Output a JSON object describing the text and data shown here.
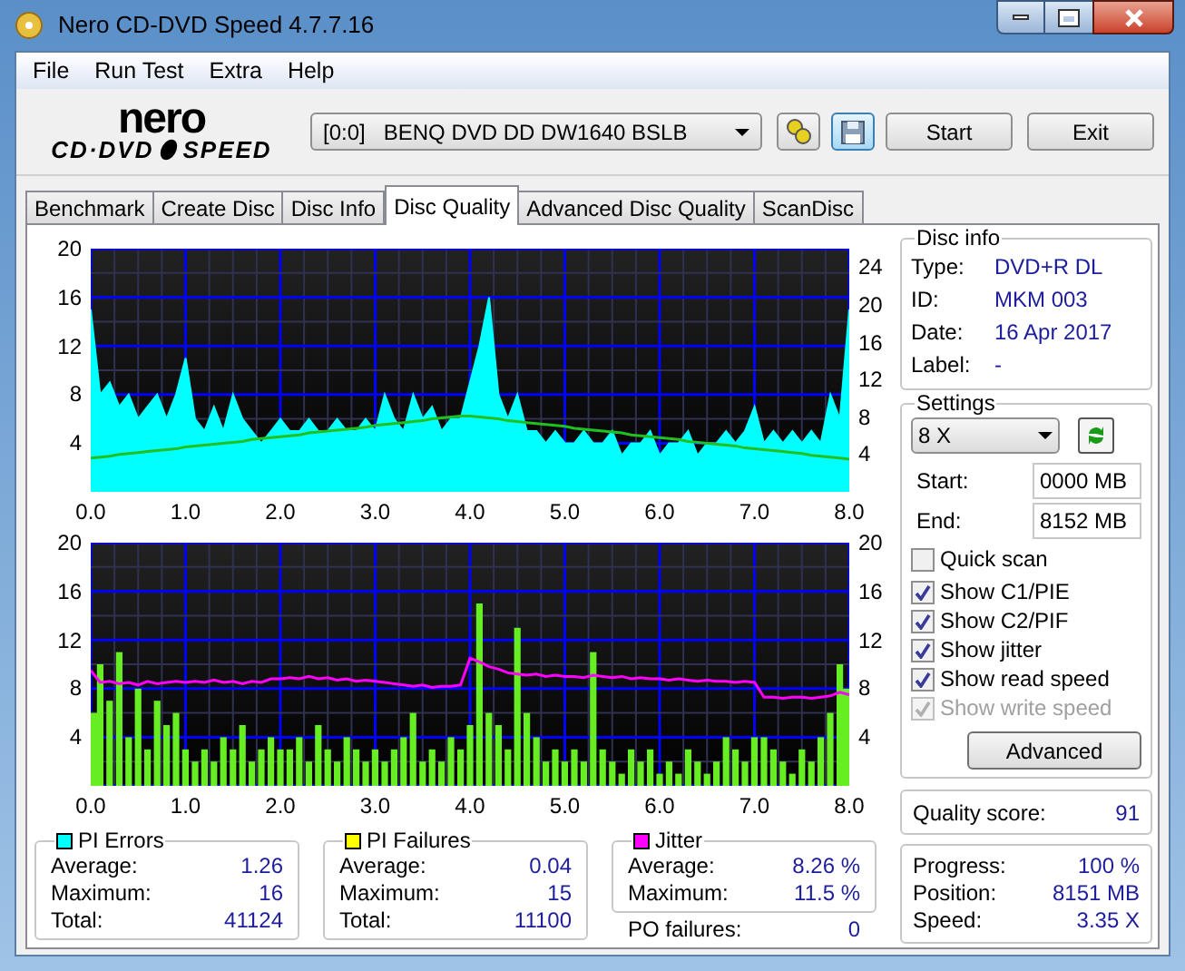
{
  "window": {
    "title": "Nero CD-DVD Speed 4.7.7.16"
  },
  "menu": [
    "File",
    "Run Test",
    "Extra",
    "Help"
  ],
  "logo": {
    "top": "nero",
    "left": "CD·DVD",
    "right": "SPEED"
  },
  "drive": {
    "value": "[0:0]   BENQ DVD DD DW1640 BSLB"
  },
  "buttons": [
    "Start",
    "Exit"
  ],
  "tabs": [
    {
      "label": "Benchmark",
      "selected": false
    },
    {
      "label": "Create Disc",
      "selected": false
    },
    {
      "label": "Disc Info",
      "selected": false
    },
    {
      "label": "Disc Quality",
      "selected": true
    },
    {
      "label": "Advanced Disc Quality",
      "selected": false
    },
    {
      "label": "ScanDisc",
      "selected": false
    }
  ],
  "charts": [
    {
      "chart_data": {
        "type": "area",
        "grid": true,
        "x": [
          0,
          0.1,
          0.2,
          0.3,
          0.4,
          0.5,
          0.6,
          0.7,
          0.8,
          0.9,
          1,
          1.1,
          1.2,
          1.3,
          1.4,
          1.5,
          1.6,
          1.7,
          1.8,
          1.9,
          2,
          2.1,
          2.2,
          2.3,
          2.4,
          2.5,
          2.6,
          2.7,
          2.8,
          2.9,
          3,
          3.1,
          3.2,
          3.3,
          3.4,
          3.5,
          3.6,
          3.7,
          3.8,
          3.9,
          4,
          4.1,
          4.2,
          4.3,
          4.4,
          4.5,
          4.6,
          4.7,
          4.8,
          4.9,
          5,
          5.1,
          5.2,
          5.3,
          5.4,
          5.5,
          5.6,
          5.7,
          5.8,
          5.9,
          6,
          6.1,
          6.2,
          6.3,
          6.4,
          6.5,
          6.6,
          6.7,
          6.8,
          6.9,
          7,
          7.1,
          7.2,
          7.3,
          7.4,
          7.5,
          7.6,
          7.7,
          7.8,
          7.9,
          8
        ],
        "series": [
          {
            "color": "#00ffff",
            "values": [
              15,
              8,
              9,
              7,
              8,
              6,
              7,
              8,
              6,
              8,
              11,
              6,
              5,
              7,
              5,
              8,
              6,
              5,
              4,
              5,
              6,
              5,
              5,
              6,
              5,
              5,
              6,
              5,
              5,
              6,
              5,
              8,
              6,
              5,
              8,
              6,
              7,
              5,
              6,
              6,
              9,
              12,
              16,
              8,
              6,
              8,
              5,
              5,
              4,
              5,
              4,
              4,
              5,
              4,
              4,
              5,
              3,
              4,
              4,
              5,
              3,
              4,
              4,
              5,
              3,
              4,
              4,
              5,
              4,
              5,
              7,
              4,
              5,
              4,
              5,
              4,
              5,
              4,
              8,
              6,
              15
            ]
          },
          {
            "type": "line",
            "axis": "y2",
            "color": "#20c020",
            "values": [
              3.6,
              3.7,
              3.8,
              4.0,
              4.1,
              4.2,
              4.3,
              4.4,
              4.5,
              4.6,
              4.8,
              4.9,
              5.0,
              5.1,
              5.2,
              5.3,
              5.4,
              5.6,
              5.7,
              5.8,
              5.9,
              6.0,
              6.1,
              6.3,
              6.4,
              6.5,
              6.6,
              6.7,
              6.8,
              6.9,
              7.1,
              7.2,
              7.3,
              7.4,
              7.5,
              7.6,
              7.8,
              7.9,
              8.0,
              8.1,
              8.1,
              8.0,
              7.9,
              7.8,
              7.6,
              7.5,
              7.4,
              7.3,
              7.2,
              7.1,
              7.0,
              6.8,
              6.7,
              6.6,
              6.5,
              6.4,
              6.3,
              6.1,
              6.0,
              5.9,
              5.8,
              5.7,
              5.6,
              5.4,
              5.3,
              5.2,
              5.1,
              5.0,
              4.9,
              4.7,
              4.6,
              4.5,
              4.4,
              4.3,
              4.2,
              4.1,
              3.9,
              3.8,
              3.7,
              3.6,
              3.5
            ]
          }
        ],
        "xlim": [
          0,
          8
        ],
        "ylim": [
          0,
          20
        ],
        "yticks": [
          20,
          16,
          12,
          8,
          4
        ],
        "y2lim": [
          0,
          26
        ],
        "y2ticks": [
          24,
          20,
          16,
          12,
          8,
          4
        ],
        "xticks": [
          {
            "value": 0,
            "label": "0.0"
          },
          {
            "value": 1,
            "label": "1.0"
          },
          {
            "value": 2,
            "label": "2.0"
          },
          {
            "value": 3,
            "label": "3.0"
          },
          {
            "value": 4,
            "label": "4.0"
          },
          {
            "value": 5,
            "label": "5.0"
          },
          {
            "value": 6,
            "label": "6.0"
          },
          {
            "value": 7,
            "label": "7.0"
          },
          {
            "value": 8,
            "label": "8.0"
          }
        ]
      }
    },
    {
      "chart_data": {
        "type": "bar",
        "grid": true,
        "x": [
          0,
          0.1,
          0.2,
          0.3,
          0.4,
          0.5,
          0.6,
          0.7,
          0.8,
          0.9,
          1,
          1.1,
          1.2,
          1.3,
          1.4,
          1.5,
          1.6,
          1.7,
          1.8,
          1.9,
          2,
          2.1,
          2.2,
          2.3,
          2.4,
          2.5,
          2.6,
          2.7,
          2.8,
          2.9,
          3,
          3.1,
          3.2,
          3.3,
          3.4,
          3.5,
          3.6,
          3.7,
          3.8,
          3.9,
          4,
          4.1,
          4.2,
          4.3,
          4.4,
          4.5,
          4.6,
          4.7,
          4.8,
          4.9,
          5,
          5.1,
          5.2,
          5.3,
          5.4,
          5.5,
          5.6,
          5.7,
          5.8,
          5.9,
          6,
          6.1,
          6.2,
          6.3,
          6.4,
          6.5,
          6.6,
          6.7,
          6.8,
          6.9,
          7,
          7.1,
          7.2,
          7.3,
          7.4,
          7.5,
          7.6,
          7.7,
          7.8,
          7.9,
          8
        ],
        "series": [
          {
            "color": "#66ee22",
            "values": [
              6,
              10,
              7,
              11,
              4,
              8,
              3,
              7,
              5,
              6,
              3,
              2,
              3,
              2,
              4,
              3,
              5,
              2,
              3,
              4,
              3,
              3,
              4,
              2,
              5,
              3,
              2,
              4,
              3,
              2,
              3,
              2,
              3,
              4,
              6,
              2,
              3,
              2,
              4,
              3,
              5,
              15,
              6,
              5,
              3,
              13,
              6,
              4,
              2,
              3,
              2,
              3,
              2,
              11,
              3,
              2,
              1,
              3,
              2,
              3,
              1,
              2,
              1,
              3,
              2,
              1,
              2,
              4,
              3,
              2,
              4,
              4,
              3,
              2,
              1,
              3,
              2,
              4,
              6,
              10,
              8
            ]
          },
          {
            "type": "line",
            "axis": "y2",
            "color": "#ff00ff",
            "values": [
              9.5,
              8.5,
              8.6,
              8.4,
              8.5,
              8.3,
              8.6,
              8.4,
              8.5,
              8.6,
              8.5,
              8.6,
              8.5,
              8.7,
              8.5,
              8.6,
              8.4,
              8.6,
              8.5,
              8.8,
              8.8,
              8.9,
              8.8,
              9.0,
              8.8,
              8.9,
              8.7,
              8.8,
              8.6,
              8.7,
              8.6,
              8.5,
              8.4,
              8.3,
              8.2,
              8.3,
              8.1,
              8.2,
              8.2,
              8.3,
              10.5,
              10.2,
              9.8,
              9.6,
              9.3,
              9.2,
              9.1,
              9.2,
              9.0,
              9.1,
              9.0,
              9.0,
              8.9,
              9.1,
              9.0,
              8.9,
              9.0,
              8.8,
              8.9,
              8.8,
              8.8,
              8.7,
              8.8,
              8.7,
              8.6,
              8.7,
              8.6,
              8.6,
              8.5,
              8.6,
              8.5,
              7.3,
              7.3,
              7.2,
              7.3,
              7.3,
              7.2,
              7.3,
              7.4,
              7.7,
              7.5
            ]
          }
        ],
        "xlim": [
          0,
          8
        ],
        "ylim": [
          0,
          20
        ],
        "yticks": [
          20,
          16,
          12,
          8,
          4
        ],
        "y2lim": [
          0,
          20
        ],
        "y2ticks": [
          20,
          16,
          12,
          8,
          4
        ],
        "xticks": [
          {
            "value": 0,
            "label": "0.0"
          },
          {
            "value": 1,
            "label": "1.0"
          },
          {
            "value": 2,
            "label": "2.0"
          },
          {
            "value": 3,
            "label": "3.0"
          },
          {
            "value": 4,
            "label": "4.0"
          },
          {
            "value": 5,
            "label": "5.0"
          },
          {
            "value": 6,
            "label": "6.0"
          },
          {
            "value": 7,
            "label": "7.0"
          },
          {
            "value": 8,
            "label": "8.0"
          }
        ]
      }
    }
  ],
  "stats": [
    {
      "title": "PI Errors",
      "color": "#00ffff",
      "rows": [
        {
          "label": "Average:",
          "value": "1.26"
        },
        {
          "label": "Maximum:",
          "value": "16"
        },
        {
          "label": "Total:",
          "value": "41124"
        }
      ]
    },
    {
      "title": "PI Failures",
      "color": "#ffff00",
      "rows": [
        {
          "label": "Average:",
          "value": "0.04"
        },
        {
          "label": "Maximum:",
          "value": "15"
        },
        {
          "label": "Total:",
          "value": "11100"
        }
      ]
    },
    {
      "title": "Jitter",
      "color": "#ff00ff",
      "rows": [
        {
          "label": "Average:",
          "value": "8.26 %"
        },
        {
          "label": "Maximum:",
          "value": "11.5 %"
        }
      ]
    }
  ],
  "po_failures": {
    "label": "PO failures:",
    "value": "0"
  },
  "disc_info": {
    "title": "Disc info",
    "rows": [
      {
        "label": "Type:",
        "value": "DVD+R DL"
      },
      {
        "label": "ID:",
        "value": "MKM 003"
      },
      {
        "label": "Date:",
        "value": "16 Apr 2017"
      },
      {
        "label": "Label:",
        "value": "-"
      }
    ]
  },
  "settings": {
    "title": "Settings",
    "speed": "8 X",
    "start_label": "Start:",
    "start": "0000 MB",
    "end_label": "End:",
    "end": "8152 MB",
    "options": [
      {
        "label": "Quick scan",
        "checked": false,
        "disabled": false
      },
      {
        "label": "Show C1/PIE",
        "checked": true,
        "disabled": false
      },
      {
        "label": "Show C2/PIF",
        "checked": true,
        "disabled": false
      },
      {
        "label": "Show jitter",
        "checked": true,
        "disabled": false
      },
      {
        "label": "Show read speed",
        "checked": true,
        "disabled": false
      },
      {
        "label": "Show write speed",
        "checked": true,
        "disabled": true
      }
    ],
    "advanced": "Advanced"
  },
  "quality": {
    "label": "Quality score:",
    "value": "91"
  },
  "progress": [
    {
      "label": "Progress:",
      "value": "100 %"
    },
    {
      "label": "Position:",
      "value": "8151 MB"
    },
    {
      "label": "Speed:",
      "value": "3.35 X"
    }
  ]
}
